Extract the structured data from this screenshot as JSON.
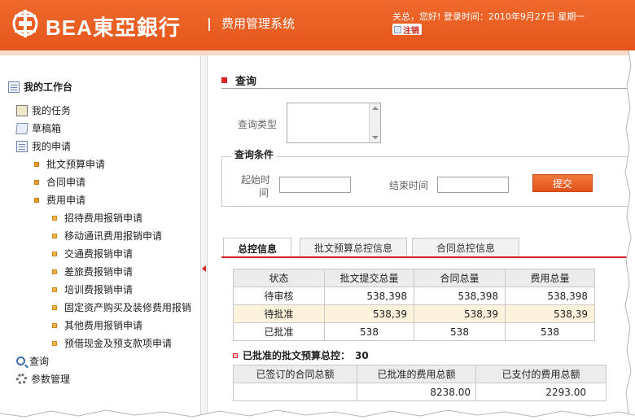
{
  "header": {
    "logo_text": "BEA東亞銀行",
    "system_name": "费用管理系统",
    "user_info": "关总，您好!  登录时间：2010年9月27日 星期一",
    "logout_label": "注销"
  },
  "sidebar": {
    "workbench_label": "我的工作台",
    "items": [
      {
        "label": "我的任务"
      },
      {
        "label": "草稿箱"
      },
      {
        "label": "我的申请"
      },
      {
        "label": "批文预算申请"
      },
      {
        "label": "合同申请"
      },
      {
        "label": "费用申请"
      },
      {
        "label": "招待费用报销申请"
      },
      {
        "label": "移动通讯费用报销申请"
      },
      {
        "label": "交通费报销申请"
      },
      {
        "label": "差旅费报销申请"
      },
      {
        "label": "培训费报销申请"
      },
      {
        "label": "固定资产购买及装修费用报销"
      },
      {
        "label": "其他费用报销申请"
      },
      {
        "label": "预借现金及预支款项申请"
      },
      {
        "label": "查询"
      },
      {
        "label": "参数管理"
      }
    ]
  },
  "main": {
    "section_title": "查询",
    "query_type_label": "查询类型",
    "conditions_legend": "查询条件",
    "start_time_label_1": "起始时",
    "start_time_label_2": "间",
    "end_time_label": "结束时间",
    "start_time_value": "",
    "end_time_value": "",
    "submit_label": "提交",
    "tabs": [
      {
        "label": "总控信息"
      },
      {
        "label": "批文预算总控信息"
      },
      {
        "label": "合同总控信息"
      }
    ],
    "table": {
      "headers": [
        "状态",
        "批文提交总量",
        "合同总量",
        "费用总量"
      ],
      "rows": [
        [
          "待审核",
          "538,398",
          "538,398",
          "538,398"
        ],
        [
          "待批准",
          "538,39",
          "538,39",
          "538,39"
        ],
        [
          "已批准",
          "538",
          "538",
          "538"
        ]
      ]
    },
    "summary_label": "已批准的批文预算总控：",
    "summary_value": "30",
    "table2": {
      "headers": [
        "已签订的合同总额",
        "已批准的费用总额",
        "已支付的费用总额"
      ],
      "rows": [
        [
          "",
          "8238.00",
          "2293.00"
        ]
      ]
    }
  },
  "colors": {
    "brand_orange": "#e5561c",
    "accent_red": "#d8262a",
    "highlight_row": "#fdf2dc"
  }
}
